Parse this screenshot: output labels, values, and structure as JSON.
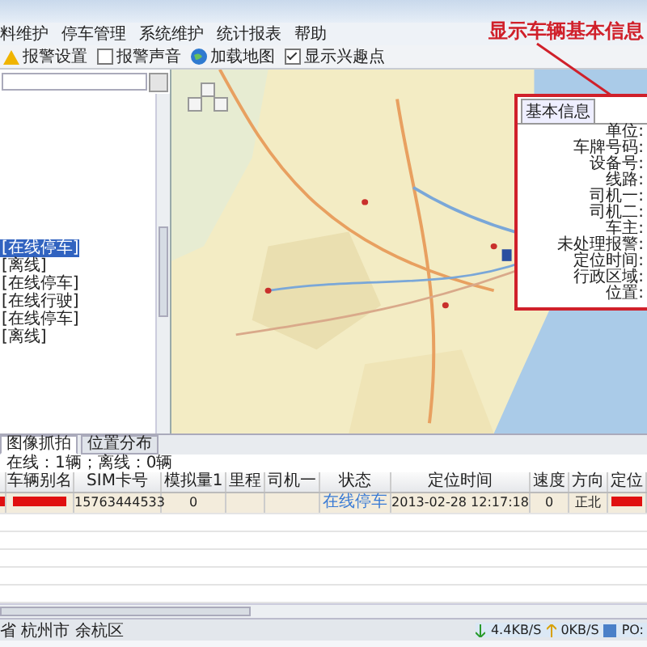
{
  "menu": [
    "料维护",
    "停车管理",
    "系统维护",
    "统计报表",
    "帮助"
  ],
  "toolbar": [
    {
      "kind": "button",
      "label": "报警设置"
    },
    {
      "kind": "checkbox",
      "label": "报警声音",
      "checked": false
    },
    {
      "kind": "button",
      "label": "加载地图"
    },
    {
      "kind": "checkbox",
      "label": "显示兴趣点",
      "checked": true
    }
  ],
  "annotation": "显示车辆基本信息",
  "tree": [
    {
      "label": "[在线停车]",
      "selected": true
    },
    {
      "label": "[离线]",
      "selected": false
    },
    {
      "label": "[在线停车]",
      "selected": false
    },
    {
      "label": "[在线行驶]",
      "selected": false
    },
    {
      "label": "[在线停车]",
      "selected": false
    },
    {
      "label": "[离线]",
      "selected": false
    }
  ],
  "info_panel": {
    "tab": "基本信息",
    "fields": [
      "单位:",
      "车牌号码:",
      "设备号:",
      "线路:",
      "司机一:",
      "司机二:",
      "车主:",
      "未处理报警:",
      "定位时间:",
      "行政区域:",
      "位置:"
    ]
  },
  "bottom_tabs": [
    {
      "label": "图像抓拍",
      "selected": true
    },
    {
      "label": "位置分布",
      "selected": false
    }
  ],
  "summary": "在线：1辆；离线：0辆",
  "table": {
    "columns": [
      "",
      "车辆别名",
      "SIM卡号",
      "模拟量1",
      "里程",
      "司机一",
      "状态",
      "定位时间",
      "速度",
      "方向",
      "定位"
    ],
    "rows": [
      [
        {
          "kind": "redacted"
        },
        {
          "kind": "redacted"
        },
        {
          "kind": "text",
          "text": "15763444533"
        },
        {
          "kind": "text",
          "text": "0"
        },
        {
          "kind": "text",
          "text": ""
        },
        {
          "kind": "text",
          "text": ""
        },
        {
          "kind": "status",
          "text": "在线停车"
        },
        {
          "kind": "text",
          "text": "2013-02-28 12:17:18"
        },
        {
          "kind": "text",
          "text": "0"
        },
        {
          "kind": "text",
          "text": "正北"
        },
        {
          "kind": "redacted"
        }
      ]
    ]
  },
  "status_bar": {
    "location": "省 杭州市 余杭区",
    "download": "4.4KB/S",
    "upload": "0KB/S",
    "extra": "PO:"
  }
}
